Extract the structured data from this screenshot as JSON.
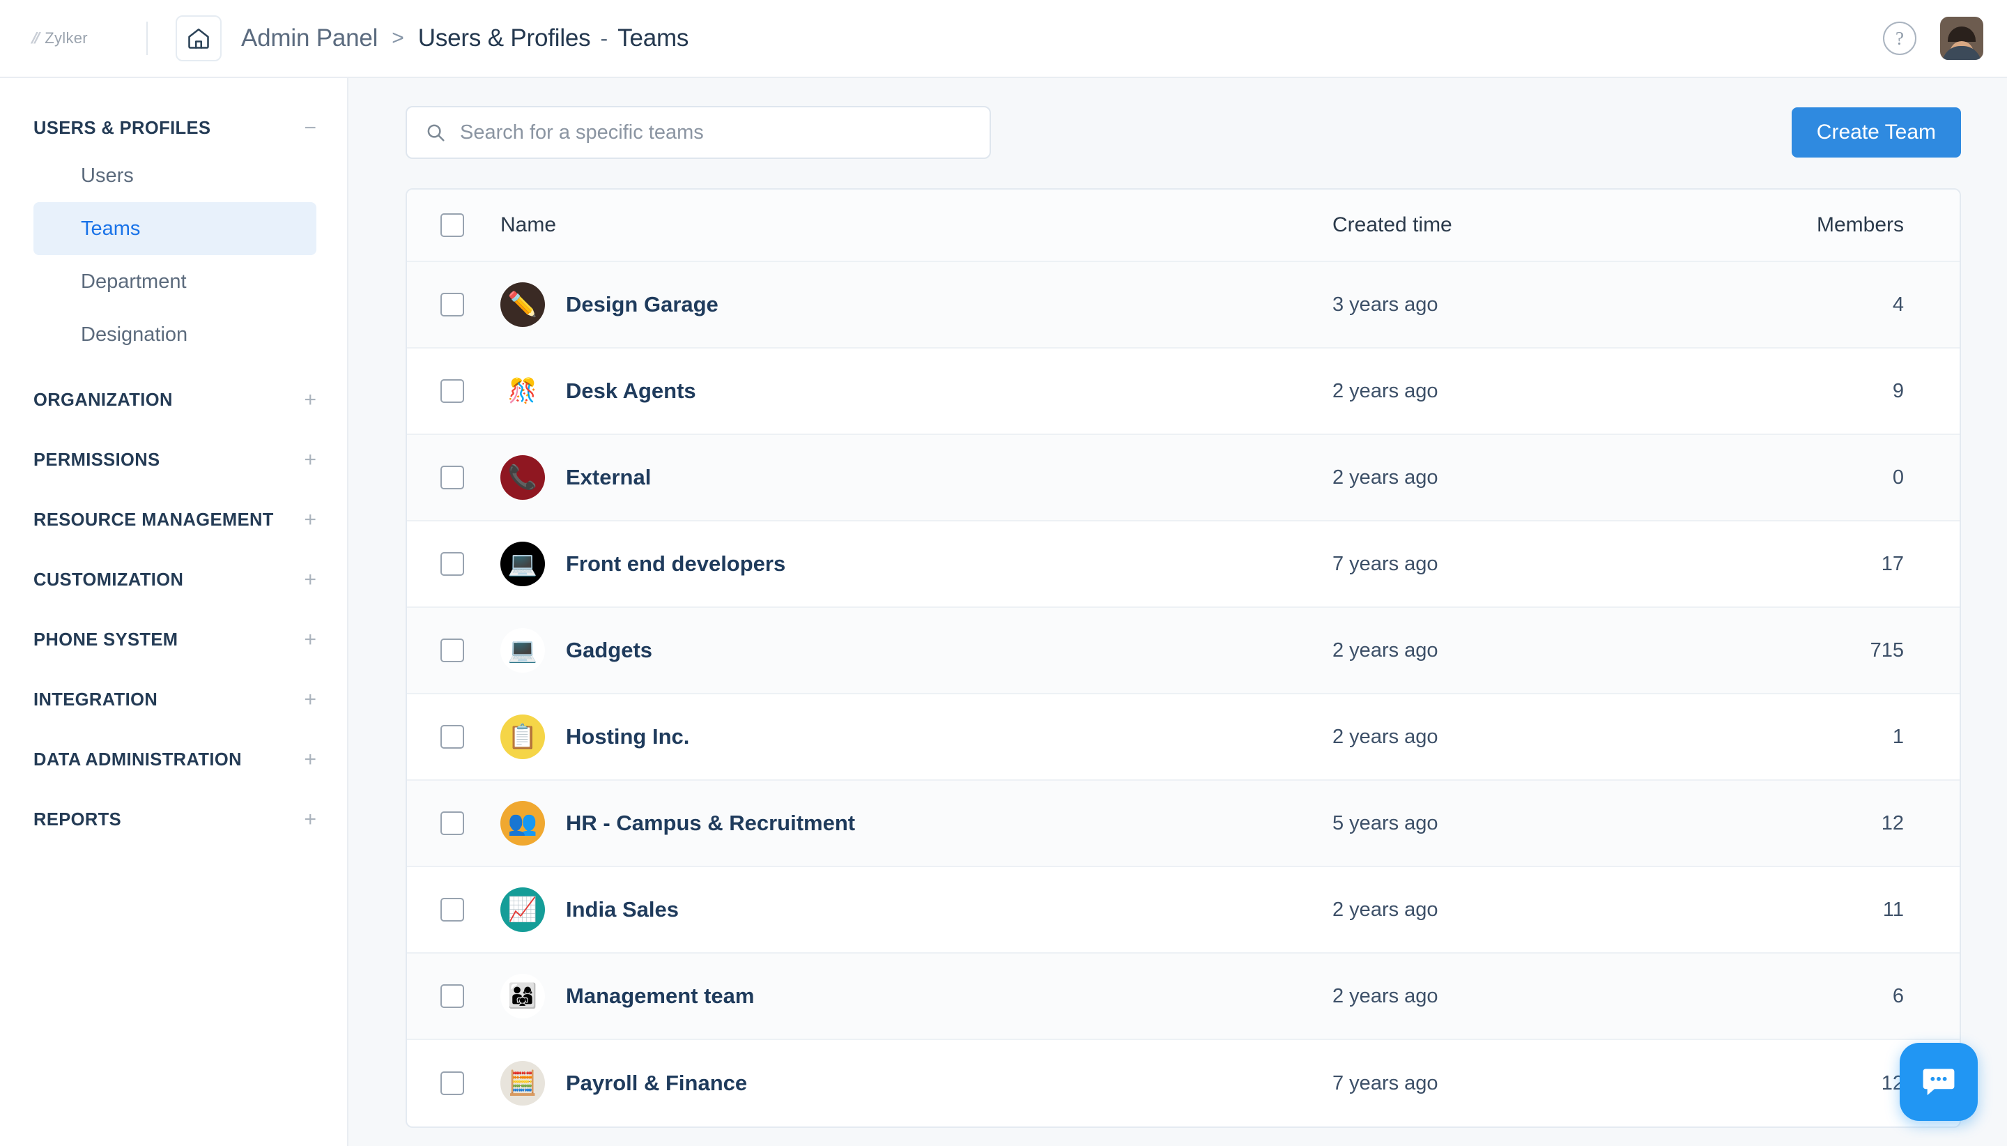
{
  "header": {
    "brand_name": "Zylker",
    "home_icon": "home-icon",
    "breadcrumb": {
      "root": "Admin Panel",
      "separator": ">",
      "section": "Users & Profiles",
      "dash": "-",
      "page": "Teams"
    },
    "help_label": "?",
    "avatar_label": "user-avatar"
  },
  "sidebar": {
    "sections": [
      {
        "title": "USERS & PROFILES",
        "toggle": "−",
        "expanded": true,
        "items": [
          {
            "label": "Users",
            "active": false
          },
          {
            "label": "Teams",
            "active": true
          },
          {
            "label": "Department",
            "active": false
          },
          {
            "label": "Designation",
            "active": false
          }
        ]
      },
      {
        "title": "ORGANIZATION",
        "toggle": "+",
        "expanded": false,
        "items": []
      },
      {
        "title": "PERMISSIONS",
        "toggle": "+",
        "expanded": false,
        "items": []
      },
      {
        "title": "RESOURCE MANAGEMENT",
        "toggle": "+",
        "expanded": false,
        "items": []
      },
      {
        "title": "CUSTOMIZATION",
        "toggle": "+",
        "expanded": false,
        "items": []
      },
      {
        "title": "PHONE SYSTEM",
        "toggle": "+",
        "expanded": false,
        "items": []
      },
      {
        "title": "INTEGRATION",
        "toggle": "+",
        "expanded": false,
        "items": []
      },
      {
        "title": "DATA ADMINISTRATION",
        "toggle": "+",
        "expanded": false,
        "items": []
      },
      {
        "title": "REPORTS",
        "toggle": "+",
        "expanded": false,
        "items": []
      }
    ]
  },
  "toolbar": {
    "search_placeholder": "Search for a specific teams",
    "search_value": "",
    "search_icon": "search-icon",
    "create_label": "Create Team"
  },
  "table": {
    "select_all_checked": false,
    "columns": [
      {
        "key": "name",
        "label": "Name"
      },
      {
        "key": "created",
        "label": "Created time"
      },
      {
        "key": "members",
        "label": "Members"
      }
    ],
    "rows": [
      {
        "name": "Design Garage",
        "created": "3 years ago",
        "members": "4",
        "avatar_bg": "#3a2a24",
        "avatar_glyph": "✏️",
        "checked": false
      },
      {
        "name": "Desk Agents",
        "created": "2 years ago",
        "members": "9",
        "avatar_bg": "#ffffff",
        "avatar_glyph": "🎊",
        "checked": false
      },
      {
        "name": "External",
        "created": "2 years ago",
        "members": "0",
        "avatar_bg": "#8f1721",
        "avatar_glyph": "📞",
        "checked": false
      },
      {
        "name": "Front end developers",
        "created": "7 years ago",
        "members": "17",
        "avatar_bg": "#000000",
        "avatar_glyph": "💻",
        "checked": false
      },
      {
        "name": "Gadgets",
        "created": "2 years ago",
        "members": "715",
        "avatar_bg": "#ffffff",
        "avatar_glyph": "💻",
        "checked": false
      },
      {
        "name": "Hosting Inc.",
        "created": "2 years ago",
        "members": "1",
        "avatar_bg": "#f5d547",
        "avatar_glyph": "📋",
        "checked": false
      },
      {
        "name": "HR - Campus & Recruitment",
        "created": "5 years ago",
        "members": "12",
        "avatar_bg": "#f0a830",
        "avatar_glyph": "👥",
        "checked": false
      },
      {
        "name": "India Sales",
        "created": "2 years ago",
        "members": "11",
        "avatar_bg": "#159d98",
        "avatar_glyph": "📈",
        "checked": false
      },
      {
        "name": "Management team",
        "created": "2 years ago",
        "members": "6",
        "avatar_bg": "#ffffff",
        "avatar_glyph": "👨‍👩‍👧",
        "checked": false
      },
      {
        "name": "Payroll & Finance",
        "created": "7 years ago",
        "members": "12",
        "avatar_bg": "#e8e4dc",
        "avatar_glyph": "🧮",
        "checked": false
      }
    ]
  },
  "chat": {
    "icon": "chat-bubble-icon"
  },
  "colors": {
    "accent": "#2f8ae0",
    "active_nav_text": "#1a73e8",
    "active_nav_bg": "#e8f1fb",
    "chat_fab": "#2196f3",
    "main_bg": "#f6f8fa",
    "team_name": "#1f3b5c"
  }
}
